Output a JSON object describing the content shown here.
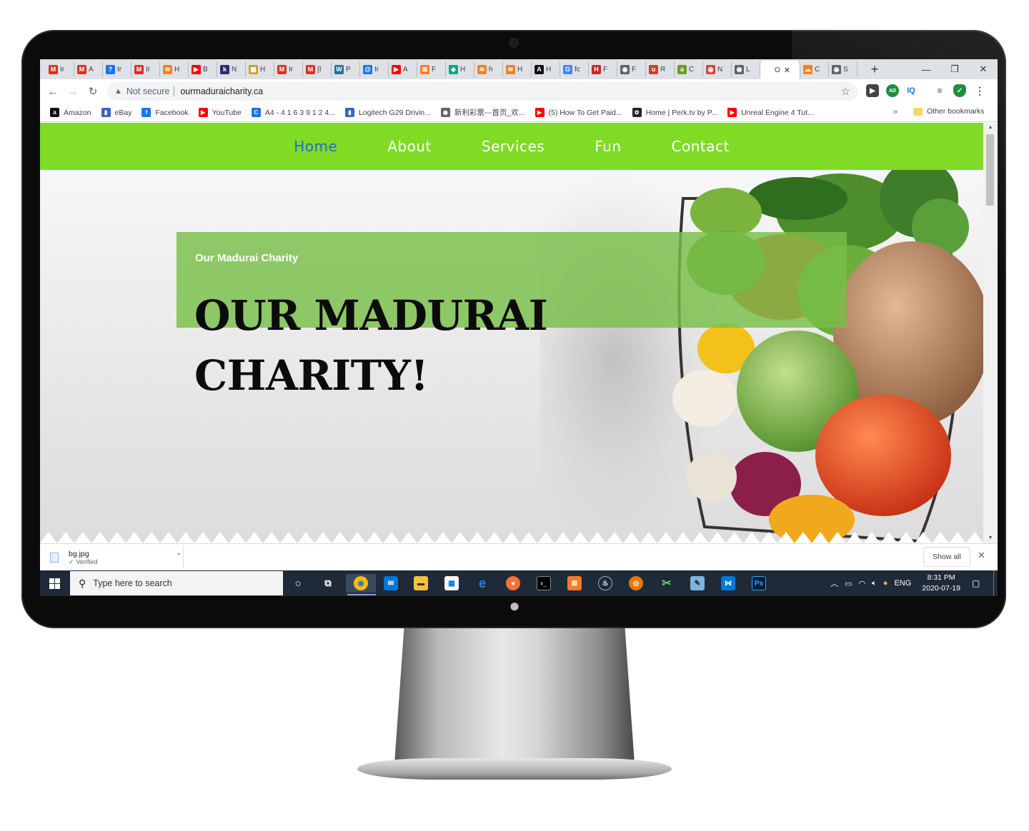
{
  "browser": {
    "tabs": [
      {
        "label": "Ir",
        "icon": "gmail-icon",
        "glyph": "M",
        "color": "#d93025"
      },
      {
        "label": "A",
        "icon": "gmail-icon",
        "glyph": "M",
        "color": "#d93025"
      },
      {
        "label": "Ir",
        "icon": "info-icon",
        "glyph": "?",
        "color": "#1a73e8"
      },
      {
        "label": "Ir",
        "icon": "gmail-icon",
        "glyph": "M",
        "color": "#d93025"
      },
      {
        "label": "H",
        "icon": "stack-icon",
        "glyph": "≋",
        "color": "#f48024"
      },
      {
        "label": "B",
        "icon": "youtube-icon",
        "glyph": "▶",
        "color": "#ff0000"
      },
      {
        "label": "N",
        "icon": "k-icon",
        "glyph": "k",
        "color": "#2d2a6e"
      },
      {
        "label": "H",
        "icon": "map-icon",
        "glyph": "▦",
        "color": "#c9a227"
      },
      {
        "label": "Ir",
        "icon": "gmail-icon",
        "glyph": "M",
        "color": "#d93025"
      },
      {
        "label": "[I",
        "icon": "gmail-icon",
        "glyph": "M",
        "color": "#d93025"
      },
      {
        "label": "P",
        "icon": "wordpress-icon",
        "glyph": "W",
        "color": "#21759b"
      },
      {
        "label": "Ir",
        "icon": "swirl-icon",
        "glyph": "@",
        "color": "#1a73e8"
      },
      {
        "label": "A",
        "icon": "youtube-icon",
        "glyph": "▶",
        "color": "#ff0000"
      },
      {
        "label": "F",
        "icon": "xampp-icon",
        "glyph": "⊠",
        "color": "#fb7a24"
      },
      {
        "label": "H",
        "icon": "shield-icon",
        "glyph": "◆",
        "color": "#0fa387"
      },
      {
        "label": "h",
        "icon": "stack-icon",
        "glyph": "≋",
        "color": "#f48024"
      },
      {
        "label": "H",
        "icon": "stack-icon",
        "glyph": "≋",
        "color": "#f48024"
      },
      {
        "label": "H",
        "icon": "unreal-icon",
        "glyph": "A",
        "color": "#111111"
      },
      {
        "label": "fc",
        "icon": "google-icon",
        "glyph": "G",
        "color": "#4285f4"
      },
      {
        "label": "F",
        "icon": "hn-icon",
        "glyph": "H",
        "color": "#c62828"
      },
      {
        "label": "F",
        "icon": "chrome-gray-icon",
        "glyph": "◉",
        "color": "#5f6368"
      },
      {
        "label": "R",
        "icon": "u-icon",
        "glyph": "u",
        "color": "#d23b3b"
      },
      {
        "label": "C",
        "icon": "a-icon",
        "glyph": "a",
        "color": "#6b9b2a"
      },
      {
        "label": "N",
        "icon": "chrome-icon",
        "glyph": "◉",
        "color": "#db4437"
      },
      {
        "label": "L",
        "icon": "globe-icon",
        "glyph": "◉",
        "color": "#5f6368"
      },
      {
        "label": "O",
        "icon": "globe-icon",
        "glyph": "",
        "color": "#5f6368",
        "active": true
      },
      {
        "label": "C",
        "icon": "cloudflare-icon",
        "glyph": "☁",
        "color": "#f38020"
      },
      {
        "label": "S",
        "icon": "globe-icon",
        "glyph": "◉",
        "color": "#5f6368"
      }
    ],
    "new_tab": "+",
    "window_controls": [
      "—",
      "❐",
      "✕"
    ],
    "address": {
      "security_label": "Not secure",
      "url": "ourmaduraicharity.ca"
    },
    "bookmarks": [
      {
        "label": "Amazon",
        "glyph": "a",
        "color": "#111111"
      },
      {
        "label": "eBay",
        "glyph": "▮",
        "color": "#3b63c4"
      },
      {
        "label": "Facebook",
        "glyph": "f",
        "color": "#1877f2"
      },
      {
        "label": "YouTube",
        "glyph": "▶",
        "color": "#ff0000"
      },
      {
        "label": "A4 - 4 1 6 3 9 1 2 4...",
        "glyph": "C",
        "color": "#1a73e8"
      },
      {
        "label": "Logitech G29 Drivin...",
        "glyph": "▮",
        "color": "#3b63c4"
      },
      {
        "label": "新利彩票---首页_欢...",
        "glyph": "◉",
        "color": "#5f6368"
      },
      {
        "label": "(5) How To Get Paid...",
        "glyph": "▶",
        "color": "#ff0000"
      },
      {
        "label": "Home | Perk.tv by P...",
        "glyph": "✿",
        "color": "#222222"
      },
      {
        "label": "Unreal Engine 4 Tut...",
        "glyph": "▶",
        "color": "#ff0000"
      }
    ],
    "bookmarks_more": "»",
    "other_bookmarks": "Other bookmarks"
  },
  "site": {
    "nav": [
      "Home",
      "About",
      "Services",
      "Fun",
      "Contact"
    ],
    "active_nav": "Home",
    "hero_kicker": "Our Madurai Charity",
    "hero_title": "OUR MADURAI CHARITY!",
    "brand_green": "#7fdb24",
    "box_green": "#77be48"
  },
  "downloads": {
    "file_name": "bg.jpg",
    "status": "Verified",
    "show_all": "Show all"
  },
  "taskbar": {
    "search_placeholder": "Type here to search",
    "apps": [
      "cortana-icon",
      "task-view-icon",
      "chrome-icon",
      "mail-icon",
      "file-explorer-icon",
      "store-icon",
      "edge-icon",
      "firefox-icon",
      "terminal-icon",
      "xampp-icon",
      "steam-icon",
      "blender-icon",
      "tools-icon",
      "notepad-icon",
      "vscode-icon",
      "photoshop-icon"
    ],
    "language": "ENG",
    "time": "8:31 PM",
    "date": "2020-07-19"
  }
}
